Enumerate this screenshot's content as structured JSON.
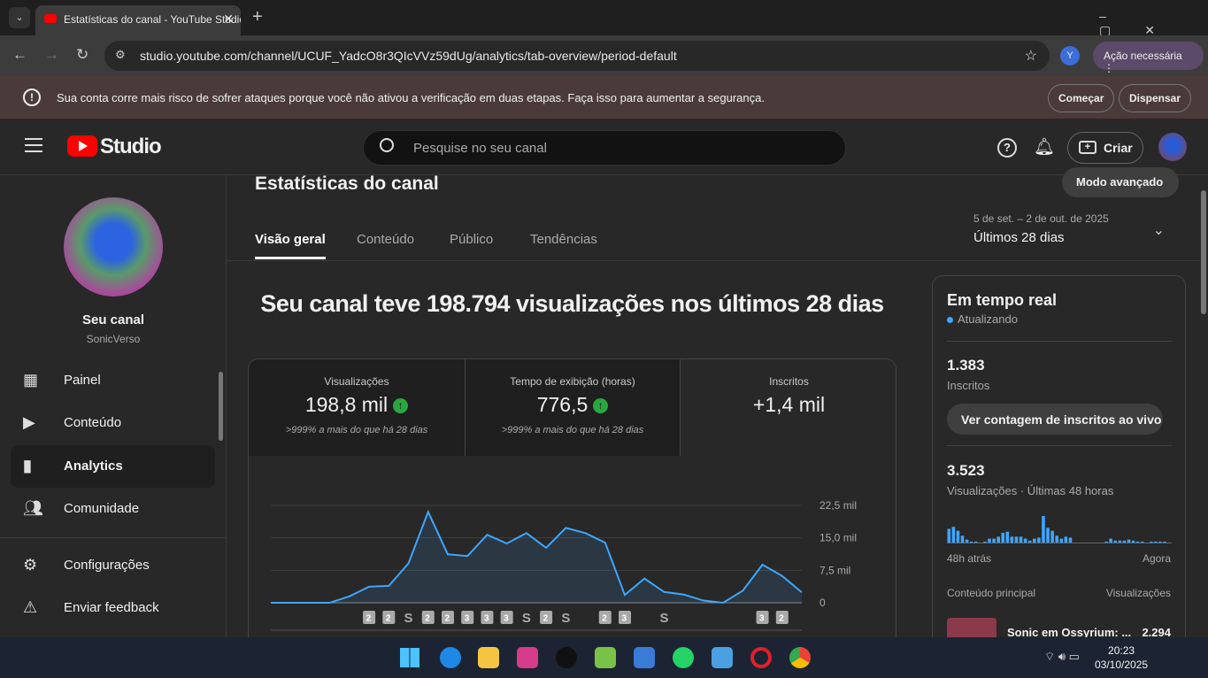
{
  "browser": {
    "tab_title": "Estatísticas do canal - YouTube Studio",
    "url": "studio.youtube.com/channel/UCUF_YadcO8r3QIcVVz59dUg/analytics/tab-overview/period-default",
    "profile_initial": "Y",
    "action_label": "Ação necessária"
  },
  "warning": {
    "text": "Sua conta corre mais risco de sofrer ataques porque você não ativou a verificação em duas etapas. Faça isso para aumentar a segurança.",
    "start": "Começar",
    "dismiss": "Dispensar"
  },
  "header": {
    "logo": "Studio",
    "search_placeholder": "Pesquise no seu canal",
    "create": "Criar"
  },
  "sidebar": {
    "channel_label": "Seu canal",
    "channel_name": "SonicVerso",
    "items": [
      {
        "label": "Painel",
        "icon": "dashboard-icon"
      },
      {
        "label": "Conteúdo",
        "icon": "content-icon"
      },
      {
        "label": "Analytics",
        "icon": "analytics-icon"
      },
      {
        "label": "Comunidade",
        "icon": "community-icon"
      }
    ],
    "bottom": [
      {
        "label": "Configurações",
        "icon": "gear-icon"
      },
      {
        "label": "Enviar feedback",
        "icon": "feedback-icon"
      }
    ]
  },
  "page": {
    "title": "Estatísticas do canal",
    "advanced": "Modo avançado",
    "tabs": [
      "Visão geral",
      "Conteúdo",
      "Público",
      "Tendências"
    ],
    "period_range": "5 de set. – 2 de out. de 2025",
    "period": "Últimos 28 dias",
    "headline": "Seu canal teve 198.794 visualizações nos últimos 28 dias"
  },
  "cards": [
    {
      "title": "Visualizações",
      "value": "198,8 mil",
      "sub": ">999% a mais do que há 28 dias",
      "up": true
    },
    {
      "title": "Tempo de exibição (horas)",
      "value": "776,5",
      "sub": ">999% a mais do que há 28 dias",
      "up": true
    },
    {
      "title": "Inscritos",
      "value": "+1,4 mil",
      "sub": "",
      "up": false
    }
  ],
  "chart_data": {
    "type": "area",
    "ylabel": "Visualizações",
    "yticks": [
      "0",
      "7,5 mil",
      "15,0 mil",
      "22,5 mil"
    ],
    "ylim": [
      0,
      22.5
    ],
    "values": [
      0,
      0,
      0,
      0,
      1.5,
      3.7,
      3.9,
      9.1,
      21,
      11.2,
      10.8,
      15.7,
      13.7,
      16.1,
      12.7,
      17.3,
      16.1,
      13.9,
      1.8,
      5.6,
      2.5,
      1.9,
      0.5,
      0,
      2.8,
      8.8,
      6.2,
      2.4
    ],
    "markers": [
      {
        "i": 5,
        "l": "2"
      },
      {
        "i": 6,
        "l": "2"
      },
      {
        "i": 7,
        "l": "S"
      },
      {
        "i": 8,
        "l": "2"
      },
      {
        "i": 9,
        "l": "2"
      },
      {
        "i": 10,
        "l": "3"
      },
      {
        "i": 11,
        "l": "3"
      },
      {
        "i": 12,
        "l": "3"
      },
      {
        "i": 13,
        "l": "S"
      },
      {
        "i": 14,
        "l": "2"
      },
      {
        "i": 15,
        "l": "S"
      },
      {
        "i": 17,
        "l": "2"
      },
      {
        "i": 18,
        "l": "3"
      },
      {
        "i": 20,
        "l": "S"
      },
      {
        "i": 25,
        "l": "3"
      },
      {
        "i": 26,
        "l": "2"
      }
    ],
    "color": "#3ea6ff"
  },
  "realtime": {
    "title": "Em tempo real",
    "status": "Atualizando",
    "subs": "1.383",
    "subs_label": "Inscritos",
    "live_button": "Ver contagem de inscritos ao vivo",
    "views": "3.523",
    "views_label": "Visualizações · Últimas 48 horas",
    "start_label": "48h atrás",
    "end_label": "Agora",
    "bars": [
      14,
      16,
      12,
      7,
      3,
      1,
      1,
      0,
      1,
      4,
      4,
      6,
      10,
      11,
      6,
      6,
      6,
      4,
      2,
      4,
      5,
      27,
      15,
      12,
      7,
      4,
      6,
      5,
      0,
      0,
      0,
      0,
      0,
      0,
      0,
      1,
      4,
      2,
      2,
      2,
      3,
      2,
      1,
      1,
      0,
      1,
      1,
      1,
      1,
      0
    ],
    "content_header": "Conteúdo principal",
    "views_header": "Visualizações",
    "top_title": "Sonic em Ossyrium: ...",
    "top_views": "2.294"
  },
  "taskbar": {
    "time": "20:23",
    "date": "03/10/2025"
  }
}
